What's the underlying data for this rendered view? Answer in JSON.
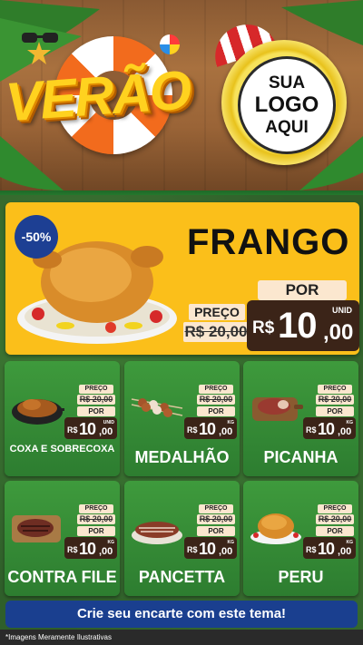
{
  "header": {
    "title": "VERÃO",
    "logo_placeholder": {
      "line1": "SUA",
      "line2": "LOGO",
      "line3": "AQUI"
    }
  },
  "hero": {
    "discount_badge": "-50%",
    "product_name": "FRANGO",
    "preco_label": "PREÇO",
    "old_price": "R$ 20,00",
    "por_label": "POR",
    "price": {
      "currency": "R$",
      "integer": "10",
      "decimal": ",00",
      "unit": "UNID"
    }
  },
  "products": [
    {
      "name": "COXA E SOBRECOXA",
      "preco_label": "PREÇO",
      "old_price": "R$ 20,00",
      "por_label": "POR",
      "currency": "R$",
      "integer": "10",
      "decimal": ",00",
      "unit": "UNID"
    },
    {
      "name": "MEDALHÃO",
      "preco_label": "PREÇO",
      "old_price": "R$ 20,00",
      "por_label": "POR",
      "currency": "R$",
      "integer": "10",
      "decimal": ",00",
      "unit": "KG"
    },
    {
      "name": "PICANHA",
      "preco_label": "PREÇO",
      "old_price": "R$ 20,00",
      "por_label": "POR",
      "currency": "R$",
      "integer": "10",
      "decimal": ",00",
      "unit": "KG"
    },
    {
      "name": "CONTRA FILE",
      "preco_label": "PREÇO",
      "old_price": "R$ 20,00",
      "por_label": "POR",
      "currency": "R$",
      "integer": "10",
      "decimal": ",00",
      "unit": "KG"
    },
    {
      "name": "PANCETTA",
      "preco_label": "PREÇO",
      "old_price": "R$ 20,00",
      "por_label": "POR",
      "currency": "R$",
      "integer": "10",
      "decimal": ",00",
      "unit": "KG"
    },
    {
      "name": "PERU",
      "preco_label": "PREÇO",
      "old_price": "R$ 20,00",
      "por_label": "POR",
      "currency": "R$",
      "integer": "10",
      "decimal": ",00",
      "unit": "KG"
    }
  ],
  "cta": {
    "label": "Crie seu encarte com este tema!"
  },
  "footer": {
    "disclaimer": "*Imagens Meramente Ilustrativas"
  },
  "colors": {
    "hero_bg": "#fbbf1a",
    "card_green": "#3e9a3c",
    "price_tag": "#3b2418",
    "cta_blue": "#1a3f8f",
    "badge_blue": "#1d3f93"
  }
}
